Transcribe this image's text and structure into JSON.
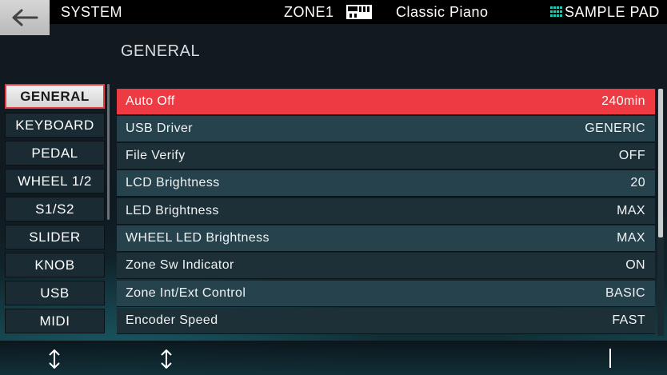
{
  "header": {
    "section": "SYSTEM",
    "zone": "ZONE1",
    "tone_name": "Classic Piano",
    "pad_label": "SAMPLE PAD",
    "back_icon": "back-arrow-icon",
    "tone_icon": "piano-icon",
    "pad_icon": "grid-icon"
  },
  "page": {
    "title": "GENERAL"
  },
  "sidebar": {
    "items": [
      {
        "label": "GENERAL",
        "active": true
      },
      {
        "label": "KEYBOARD"
      },
      {
        "label": "PEDAL"
      },
      {
        "label": "WHEEL 1/2"
      },
      {
        "label": "S1/S2"
      },
      {
        "label": "SLIDER"
      },
      {
        "label": "KNOB"
      },
      {
        "label": "USB"
      },
      {
        "label": "MIDI"
      }
    ]
  },
  "settings": {
    "rows": [
      {
        "name": "Auto Off",
        "value": "240min",
        "selected": true
      },
      {
        "name": "USB Driver",
        "value": "GENERIC"
      },
      {
        "name": "File Verify",
        "value": "OFF"
      },
      {
        "name": "LCD Brightness",
        "value": "20"
      },
      {
        "name": "LED Brightness",
        "value": "MAX"
      },
      {
        "name": "WHEEL LED Brightness",
        "value": "MAX"
      },
      {
        "name": "Zone Sw Indicator",
        "value": "ON"
      },
      {
        "name": "Zone Int/Ext Control",
        "value": "BASIC"
      },
      {
        "name": "Encoder Speed",
        "value": "FAST"
      }
    ]
  },
  "colors": {
    "accent": "#ee3a43",
    "row_dark": "#1d3038",
    "row_light": "#26424c"
  },
  "footer": {
    "left_icon": "up-down-arrow-icon",
    "mid_icon": "up-down-arrow-icon",
    "right_icon": "cursor-bar-icon"
  }
}
